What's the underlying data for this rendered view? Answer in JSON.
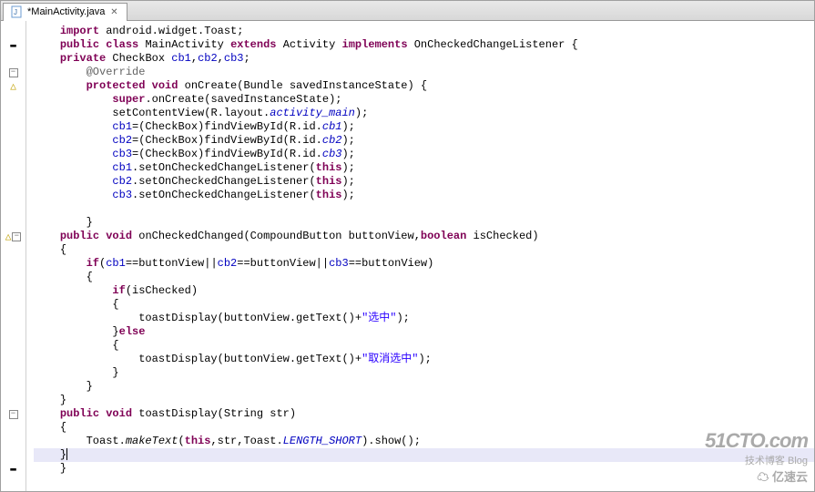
{
  "tab": {
    "filename": "*MainActivity.java",
    "close_tooltip": "Close"
  },
  "code": {
    "lines": [
      {
        "gutter": "",
        "segs": [
          {
            "c": "kw",
            "t": "import"
          },
          {
            "c": "plain",
            "t": " android.widget.Toast;"
          }
        ]
      },
      {
        "gutter": "indent",
        "segs": [
          {
            "c": "kw",
            "t": "public"
          },
          {
            "c": "plain",
            "t": " "
          },
          {
            "c": "kw",
            "t": "class"
          },
          {
            "c": "plain",
            "t": " MainActivity "
          },
          {
            "c": "kw",
            "t": "extends"
          },
          {
            "c": "plain",
            "t": " Activity "
          },
          {
            "c": "kw",
            "t": "implements"
          },
          {
            "c": "plain",
            "t": " OnCheckedChangeListener {"
          }
        ]
      },
      {
        "gutter": "",
        "segs": [
          {
            "c": "kw",
            "t": "private"
          },
          {
            "c": "plain",
            "t": " CheckBox "
          },
          {
            "c": "field",
            "t": "cb1"
          },
          {
            "c": "plain",
            "t": ","
          },
          {
            "c": "field",
            "t": "cb2"
          },
          {
            "c": "plain",
            "t": ","
          },
          {
            "c": "field",
            "t": "cb3"
          },
          {
            "c": "plain",
            "t": ";"
          }
        ]
      },
      {
        "gutter": "fold",
        "indent": 1,
        "segs": [
          {
            "c": "annotation",
            "t": "@Override"
          }
        ]
      },
      {
        "gutter": "warning",
        "indent": 1,
        "segs": [
          {
            "c": "kw",
            "t": "protected"
          },
          {
            "c": "plain",
            "t": " "
          },
          {
            "c": "kw",
            "t": "void"
          },
          {
            "c": "plain",
            "t": " onCreate(Bundle savedInstanceState) {"
          }
        ]
      },
      {
        "gutter": "",
        "indent": 2,
        "segs": [
          {
            "c": "kw",
            "t": "super"
          },
          {
            "c": "plain",
            "t": ".onCreate(savedInstanceState);"
          }
        ]
      },
      {
        "gutter": "",
        "indent": 2,
        "segs": [
          {
            "c": "plain",
            "t": "setContentView(R.layout."
          },
          {
            "c": "staticfield",
            "t": "activity_main"
          },
          {
            "c": "plain",
            "t": ");"
          }
        ]
      },
      {
        "gutter": "",
        "indent": 2,
        "segs": [
          {
            "c": "field",
            "t": "cb1"
          },
          {
            "c": "plain",
            "t": "=(CheckBox)findViewById(R.id."
          },
          {
            "c": "staticfield",
            "t": "cb1"
          },
          {
            "c": "plain",
            "t": ");"
          }
        ]
      },
      {
        "gutter": "",
        "indent": 2,
        "segs": [
          {
            "c": "field",
            "t": "cb2"
          },
          {
            "c": "plain",
            "t": "=(CheckBox)findViewById(R.id."
          },
          {
            "c": "staticfield",
            "t": "cb2"
          },
          {
            "c": "plain",
            "t": ");"
          }
        ]
      },
      {
        "gutter": "",
        "indent": 2,
        "segs": [
          {
            "c": "field",
            "t": "cb3"
          },
          {
            "c": "plain",
            "t": "=(CheckBox)findViewById(R.id."
          },
          {
            "c": "staticfield",
            "t": "cb3"
          },
          {
            "c": "plain",
            "t": ");"
          }
        ]
      },
      {
        "gutter": "",
        "indent": 2,
        "segs": [
          {
            "c": "field",
            "t": "cb1"
          },
          {
            "c": "plain",
            "t": ".setOnCheckedChangeListener("
          },
          {
            "c": "kw",
            "t": "this"
          },
          {
            "c": "plain",
            "t": ");"
          }
        ]
      },
      {
        "gutter": "",
        "indent": 2,
        "segs": [
          {
            "c": "field",
            "t": "cb2"
          },
          {
            "c": "plain",
            "t": ".setOnCheckedChangeListener("
          },
          {
            "c": "kw",
            "t": "this"
          },
          {
            "c": "plain",
            "t": ");"
          }
        ]
      },
      {
        "gutter": "",
        "indent": 2,
        "segs": [
          {
            "c": "field",
            "t": "cb3"
          },
          {
            "c": "plain",
            "t": ".setOnCheckedChangeListener("
          },
          {
            "c": "kw",
            "t": "this"
          },
          {
            "c": "plain",
            "t": ");"
          }
        ]
      },
      {
        "gutter": "",
        "indent": 0,
        "segs": [
          {
            "c": "plain",
            "t": ""
          }
        ]
      },
      {
        "gutter": "",
        "indent": 1,
        "segs": [
          {
            "c": "plain",
            "t": "}"
          }
        ]
      },
      {
        "gutter": "warning-fold",
        "segs": [
          {
            "c": "kw",
            "t": "public"
          },
          {
            "c": "plain",
            "t": " "
          },
          {
            "c": "kw",
            "t": "void"
          },
          {
            "c": "plain",
            "t": " onCheckedChanged(CompoundButton buttonView,"
          },
          {
            "c": "kw",
            "t": "boolean"
          },
          {
            "c": "plain",
            "t": " isChecked)"
          }
        ]
      },
      {
        "gutter": "",
        "segs": [
          {
            "c": "plain",
            "t": "{"
          }
        ]
      },
      {
        "gutter": "",
        "indent": 1,
        "segs": [
          {
            "c": "kw",
            "t": "if"
          },
          {
            "c": "plain",
            "t": "("
          },
          {
            "c": "field",
            "t": "cb1"
          },
          {
            "c": "plain",
            "t": "==buttonView||"
          },
          {
            "c": "field",
            "t": "cb2"
          },
          {
            "c": "plain",
            "t": "==buttonView||"
          },
          {
            "c": "field",
            "t": "cb3"
          },
          {
            "c": "plain",
            "t": "==buttonView)"
          }
        ]
      },
      {
        "gutter": "",
        "indent": 1,
        "segs": [
          {
            "c": "plain",
            "t": "{"
          }
        ]
      },
      {
        "gutter": "",
        "indent": 2,
        "segs": [
          {
            "c": "kw",
            "t": "if"
          },
          {
            "c": "plain",
            "t": "(isChecked)"
          }
        ]
      },
      {
        "gutter": "",
        "indent": 2,
        "segs": [
          {
            "c": "plain",
            "t": "{"
          }
        ]
      },
      {
        "gutter": "",
        "indent": 3,
        "segs": [
          {
            "c": "plain",
            "t": "toastDisplay(buttonView.getText()+"
          },
          {
            "c": "str",
            "t": "\"选中\""
          },
          {
            "c": "plain",
            "t": ");"
          }
        ]
      },
      {
        "gutter": "",
        "indent": 2,
        "segs": [
          {
            "c": "plain",
            "t": "}"
          },
          {
            "c": "kw",
            "t": "else"
          }
        ]
      },
      {
        "gutter": "",
        "indent": 2,
        "segs": [
          {
            "c": "plain",
            "t": "{"
          }
        ]
      },
      {
        "gutter": "",
        "indent": 3,
        "segs": [
          {
            "c": "plain",
            "t": "toastDisplay(buttonView.getText()+"
          },
          {
            "c": "str",
            "t": "\"取消选中\""
          },
          {
            "c": "plain",
            "t": ");"
          }
        ]
      },
      {
        "gutter": "",
        "indent": 2,
        "segs": [
          {
            "c": "plain",
            "t": "}"
          }
        ]
      },
      {
        "gutter": "",
        "indent": 1,
        "segs": [
          {
            "c": "plain",
            "t": "}"
          }
        ]
      },
      {
        "gutter": "",
        "segs": [
          {
            "c": "plain",
            "t": "}"
          }
        ]
      },
      {
        "gutter": "fold",
        "segs": [
          {
            "c": "kw",
            "t": "public"
          },
          {
            "c": "plain",
            "t": " "
          },
          {
            "c": "kw",
            "t": "void"
          },
          {
            "c": "plain",
            "t": " toastDisplay(String str)"
          }
        ]
      },
      {
        "gutter": "",
        "segs": [
          {
            "c": "plain",
            "t": "{"
          }
        ]
      },
      {
        "gutter": "",
        "indent": 1,
        "segs": [
          {
            "c": "plain",
            "t": "Toast."
          },
          {
            "c": "staticmethod",
            "t": "makeText"
          },
          {
            "c": "plain",
            "t": "("
          },
          {
            "c": "kw",
            "t": "this"
          },
          {
            "c": "plain",
            "t": ",str,Toast."
          },
          {
            "c": "staticfield",
            "t": "LENGTH_SHORT"
          },
          {
            "c": "plain",
            "t": ").show();"
          }
        ]
      },
      {
        "gutter": "",
        "highlight": true,
        "cursor": true,
        "segs": [
          {
            "c": "plain",
            "t": "}"
          }
        ]
      },
      {
        "gutter": "indent",
        "segs": [
          {
            "c": "plain",
            "t": "}"
          }
        ]
      }
    ]
  },
  "watermark": {
    "line1": "51CTO.com",
    "line2": "技术博客    Blog",
    "line3": "亿速云"
  }
}
